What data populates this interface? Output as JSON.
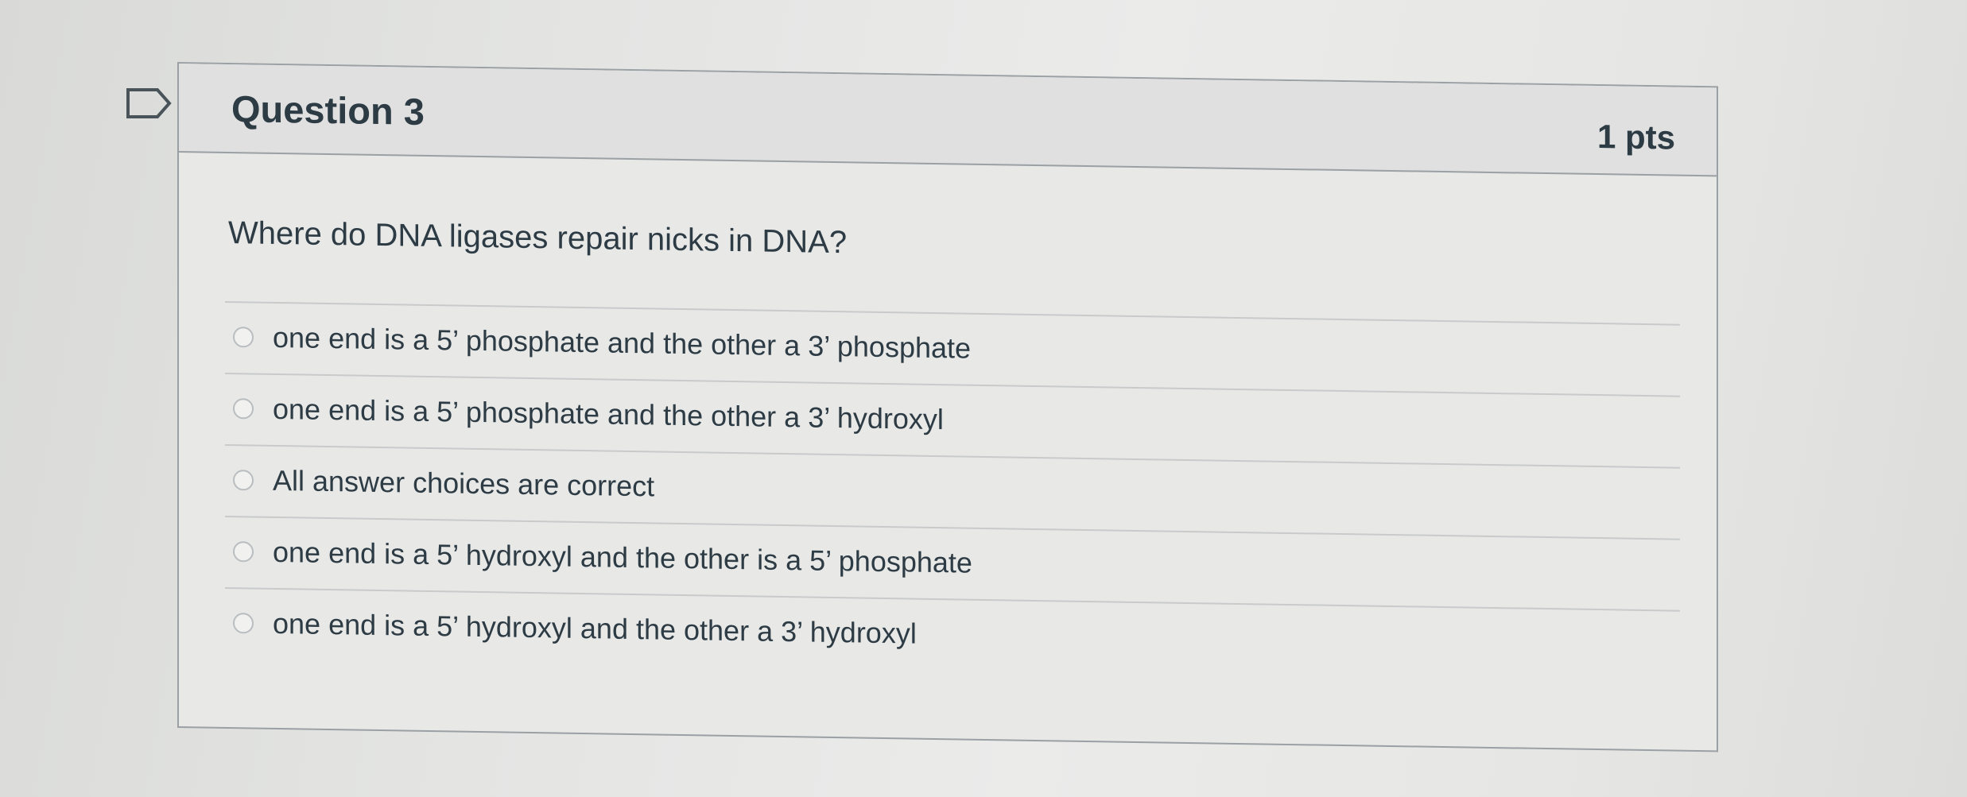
{
  "icons": {
    "bookmark": "bookmark-flag-icon"
  },
  "question": {
    "title": "Question 3",
    "points": "1 pts",
    "text": "Where do DNA ligases repair nicks in DNA?",
    "answers": [
      {
        "label": "one end is a 5’ phosphate and the other a 3’ phosphate"
      },
      {
        "label": "one end is a 5’ phosphate and the other a 3’ hydroxyl"
      },
      {
        "label": "All answer choices are correct"
      },
      {
        "label": "one end is a 5’ hydroxyl and the other is a 5’ phosphate"
      },
      {
        "label": "one end is a 5’ hydroxyl and the other a 3’ hydroxyl"
      }
    ]
  },
  "colors": {
    "text": "#2d3b45",
    "border": "#9aa0a4",
    "header_bg": "#dfe0df",
    "card_bg": "#e8e8e7",
    "divider": "#c8cacb"
  }
}
